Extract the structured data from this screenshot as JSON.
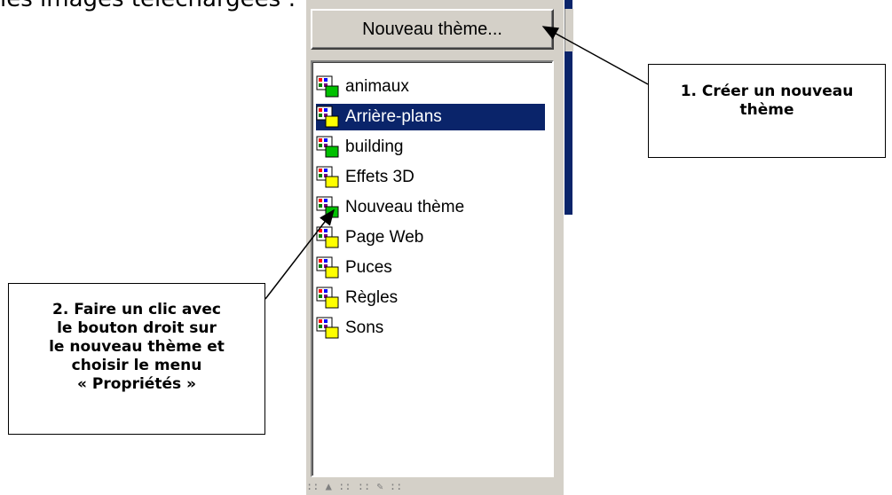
{
  "top_caption": "les images téléchargées :",
  "button": {
    "new_theme_label": "Nouveau thème..."
  },
  "theme_list": {
    "items": [
      {
        "label": "animaux",
        "selected": false,
        "badge_color": "#00c000"
      },
      {
        "label": "Arrière-plans",
        "selected": true,
        "badge_color": "#ffff00"
      },
      {
        "label": "building",
        "selected": false,
        "badge_color": "#00c000"
      },
      {
        "label": "Effets 3D",
        "selected": false,
        "badge_color": "#ffff00"
      },
      {
        "label": "Nouveau thème",
        "selected": false,
        "badge_color": "#00c000"
      },
      {
        "label": "Page Web",
        "selected": false,
        "badge_color": "#ffff00"
      },
      {
        "label": "Puces",
        "selected": false,
        "badge_color": "#ffff00"
      },
      {
        "label": "Règles",
        "selected": false,
        "badge_color": "#ffff00"
      },
      {
        "label": "Sons",
        "selected": false,
        "badge_color": "#ffff00"
      }
    ]
  },
  "status_strip": {
    "text": ":: ▲ :: :: ✎ ::"
  },
  "callouts": {
    "callout1": {
      "line1": "1. Créer un nouveau",
      "line2": "thème"
    },
    "callout2": {
      "line1": "2. Faire un clic avec",
      "line2": "le bouton droit sur",
      "line3": "le nouveau thème et",
      "line4": "choisir le menu",
      "line5": "« Propriétés »"
    }
  },
  "colors": {
    "selection": "#0a246a",
    "window_gray": "#d4d0c8"
  }
}
